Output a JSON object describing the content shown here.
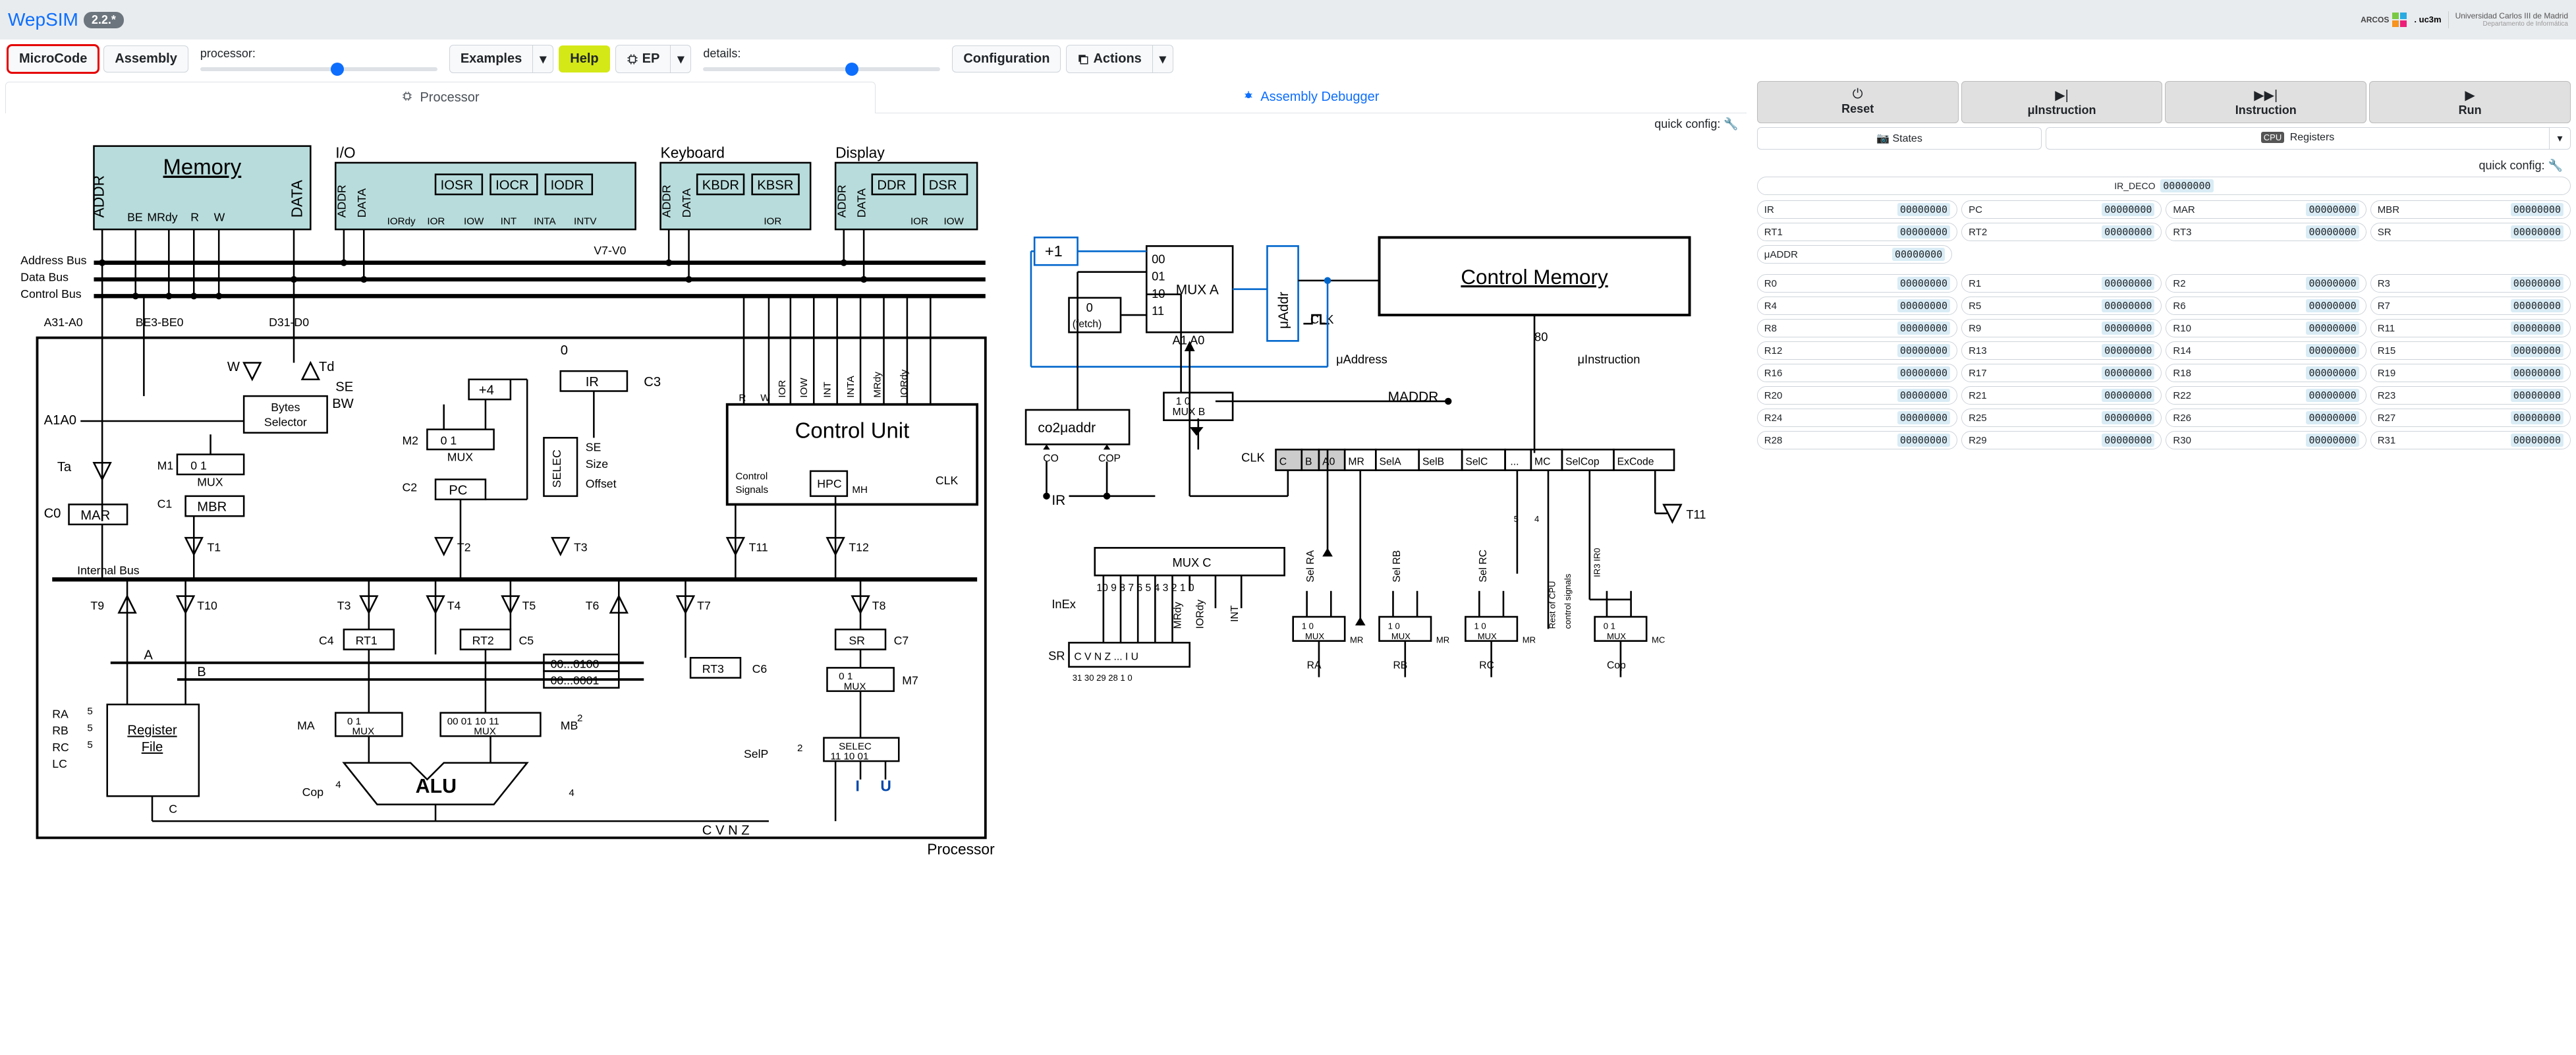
{
  "header": {
    "brand": "WepSIM",
    "version": "2.2.*",
    "arcos": "ARCOS",
    "uc3m": ". uc3m",
    "univ_top": "Universidad Carlos III de Madrid",
    "univ_bot": "Departamento de Informática"
  },
  "toolbar": {
    "microcode": "MicroCode",
    "assembly": "Assembly",
    "processor_label": "processor:",
    "examples": "Examples",
    "help": "Help",
    "ep": "EP",
    "details_label": "details:",
    "configuration": "Configuration",
    "actions": "Actions"
  },
  "tabs": {
    "processor": "Processor",
    "debugger": "Assembly Debugger"
  },
  "quick_config": "quick config:",
  "exec": {
    "reset": "Reset",
    "uinstr": "μInstruction",
    "instr": "Instruction",
    "run": "Run"
  },
  "states": {
    "states_btn": "States",
    "registers_btn": "Registers",
    "cpu_badge": "CPU"
  },
  "ir_deco": {
    "label": "IR_DECO",
    "value": "00000000"
  },
  "special_regs_row1": [
    {
      "name": "IR",
      "value": "00000000"
    },
    {
      "name": "PC",
      "value": "00000000"
    },
    {
      "name": "MAR",
      "value": "00000000"
    },
    {
      "name": "MBR",
      "value": "00000000"
    }
  ],
  "special_regs_row2": [
    {
      "name": "RT1",
      "value": "00000000"
    },
    {
      "name": "RT2",
      "value": "00000000"
    },
    {
      "name": "RT3",
      "value": "00000000"
    },
    {
      "name": "SR",
      "value": "00000000"
    }
  ],
  "uaddr": {
    "name": "μADDR",
    "value": "00000000"
  },
  "gpr": [
    [
      "R0",
      "R1",
      "R2",
      "R3"
    ],
    [
      "R4",
      "R5",
      "R6",
      "R7"
    ],
    [
      "R8",
      "R9",
      "R10",
      "R11"
    ],
    [
      "R12",
      "R13",
      "R14",
      "R15"
    ],
    [
      "R16",
      "R17",
      "R18",
      "R19"
    ],
    [
      "R20",
      "R21",
      "R22",
      "R23"
    ],
    [
      "R24",
      "R25",
      "R26",
      "R27"
    ],
    [
      "R28",
      "R29",
      "R30",
      "R31"
    ]
  ],
  "gpr_value": "00000000",
  "diagram": {
    "memory": "Memory",
    "io": "I/O",
    "keyboard": "Keyboard",
    "display": "Display",
    "iosr": "IOSR",
    "iocr": "IOCR",
    "iodr": "IODR",
    "kbdr": "KBDR",
    "kbsr": "KBSR",
    "ddr": "DDR",
    "dsr": "DSR",
    "addr": "ADDR",
    "data": "DATA",
    "be": "BE",
    "mrdy": "MRdy",
    "r": "R",
    "w": "W",
    "iordy": "IORdy",
    "ior": "IOR",
    "iow": "IOW",
    "int": "INT",
    "inta": "INTA",
    "intv": "INTV",
    "address_bus": "Address Bus",
    "data_bus": "Data Bus",
    "control_bus": "Control Bus",
    "a31a0": "A31-A0",
    "be3be0": "BE3-BE0",
    "d31d0": "D31-D0",
    "v7v0": "V7-V0",
    "control_unit": "Control Unit",
    "se": "SE",
    "size": "Size",
    "offset": "Offset",
    "control_signals": "Control\nSignals",
    "clk": "CLK",
    "hpc": "HPC",
    "mh": "MH",
    "ir": "IR",
    "c3": "C3",
    "plus4": "+4",
    "mux": "MUX",
    "pc": "PC",
    "mar": "MAR",
    "mbr": "MBR",
    "m1": "M1",
    "c1": "C1",
    "m2": "M2",
    "c2": "C2",
    "t1": "T1",
    "t2": "T2",
    "t11": "T11",
    "t12": "T12",
    "ta": "Ta",
    "c0": "C0",
    "td": "Td",
    "bw": "BW",
    "a1a0": "A1A0",
    "bytes_selector": "Bytes\nSelector",
    "internal_bus": "Internal Bus",
    "t9": "T9",
    "t10": "T10",
    "a": "A",
    "b": "B",
    "ra": "RA",
    "rb": "RB",
    "rc": "RC",
    "lc": "LC",
    "register_file": "Register\nFile",
    "c": "C",
    "t3": "T3",
    "t4": "T4",
    "t5": "T5",
    "t6": "T6",
    "t7": "T7",
    "t8": "T8",
    "c4": "C4",
    "c5": "C5",
    "c6": "C6",
    "c7": "C7",
    "rt1": "RT1",
    "rt2": "RT2",
    "rt3": "RT3",
    "sr": "SR",
    "alu": "ALU",
    "cop": "Cop",
    "ma": "MA",
    "mb": "MB",
    "m7": "M7",
    "selp": "SelP",
    "selec": "SELEC",
    "cvnz": "C  V  N  Z",
    "iu_i": "I",
    "iu_u": "U",
    "processor_label": "Processor",
    "pat0100": "00...0100",
    "pat0001": "00...0001",
    "sel_1110": "11  10  01",
    "mux_0010": "00 01 10 11",
    "plus1": "+1",
    "uaddr": "μAddr",
    "control_memory": "Control Memory",
    "fetch": "0\n(fetch)",
    "muxa": "MUX A",
    "muxb": "MUX B",
    "muxc": "MUX C",
    "a1_a0": "A1   A0",
    "co2uaddr": "co2μaddr",
    "co": "CO",
    "cop_small": "COP",
    "maddr": "MADDR",
    "uaddress": "μAddress",
    "uinstruction": "μInstruction",
    "cba0": "C B A0",
    "mr": "MR",
    "sela": "SelA",
    "selb": "SelB",
    "selc": "SelC",
    "dots": "...",
    "mc": "MC",
    "selcop": "SelCop",
    "excode": "ExCode",
    "inex": "InEx",
    "cvnz_iu": "C V N Z ... I U",
    "sr_bits": "31 30 29 28       1  0",
    "mrdy2": "MRdy",
    "int2": "INT",
    "sel_ra": "Sel RA",
    "sel_rb": "Sel RB",
    "sel_rc": "Sel RC",
    "rest": "Rest of CPU\ncontrol signals",
    "ir3": "IR3  IR0",
    "nums": "10  9  8  7  6     5  4  3   2 1 0",
    "t11_2": "T11",
    "eighty": "80",
    "zero": "0",
    "one": "1",
    "four": "4",
    "five": "5",
    "two": "2",
    "n00": "00",
    "n01": "01",
    "n10": "10",
    "n11": "11"
  }
}
